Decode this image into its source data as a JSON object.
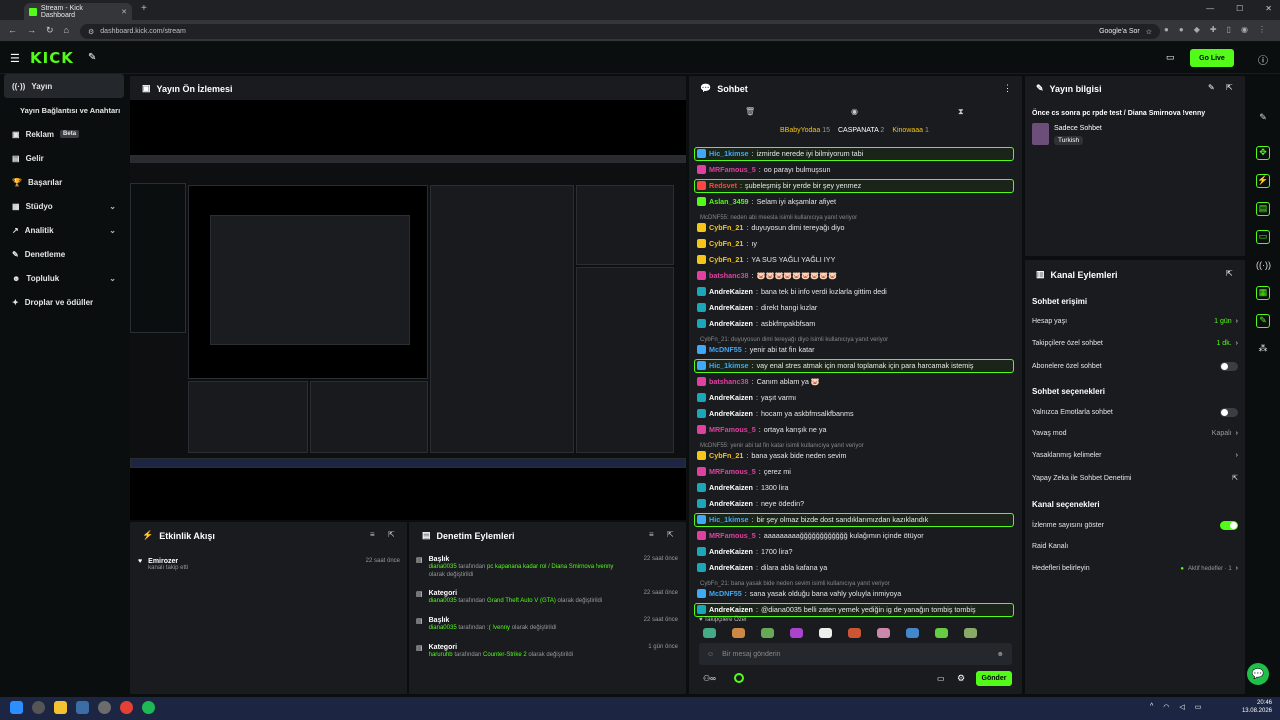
{
  "browser": {
    "tab_title": "Stream - Kick Dashboard",
    "url": "dashboard.kick.com/stream",
    "google_label": "Google'a Sor"
  },
  "header": {
    "logo": "KICK",
    "go_live": "Go Live"
  },
  "sidebar": {
    "items": [
      {
        "label": "Yayın",
        "icon": "broadcast-icon",
        "active": true
      },
      {
        "label": "Yayın Bağlantısı ve Anahtarı",
        "icon": "",
        "sub": true
      },
      {
        "label": "Reklam",
        "icon": "ad-icon",
        "badge": "Beta"
      },
      {
        "label": "Gelir",
        "icon": "revenue-icon"
      },
      {
        "label": "Başarılar",
        "icon": "trophy-icon"
      },
      {
        "label": "Stüdyo",
        "icon": "studio-icon",
        "chev": true
      },
      {
        "label": "Analitik",
        "icon": "analytics-icon",
        "chev": true
      },
      {
        "label": "Denetleme",
        "icon": "moderation-icon"
      },
      {
        "label": "Topluluk",
        "icon": "community-icon",
        "chev": true
      },
      {
        "label": "Droplar ve ödüller",
        "icon": "gift-icon"
      }
    ]
  },
  "preview": {
    "title": "Yayın Ön İzlemesi"
  },
  "activity": {
    "title": "Etkinlik Akışı",
    "items": [
      {
        "user": "Emirozer",
        "text": "kanalı takip etti",
        "time": "22 saat önce"
      }
    ]
  },
  "mod": {
    "title": "Denetim Eylemleri",
    "items": [
      {
        "type": "Başlık",
        "user": "diana0035",
        "mid": "tarafından",
        "value": "pc kapanana kadar rol / Diana Smirnova !venny",
        "end": "olarak değiştirildi",
        "time": "22 saat önce"
      },
      {
        "type": "Kategori",
        "user": "diana0035",
        "mid": "tarafından",
        "value": "Grand Theft Auto V (GTA)",
        "end": "olarak değiştirildi",
        "time": "22 saat önce"
      },
      {
        "type": "Başlık",
        "user": "diana0035",
        "mid": "tarafından",
        "value": ":( !venny",
        "end": "olarak değiştirildi",
        "time": "22 saat önce"
      },
      {
        "type": "Kategori",
        "user": "haruruhb",
        "mid": "tarafından",
        "value": "Counter-Strike 2",
        "end": "olarak değiştirildi",
        "time": "1 gün önce"
      }
    ]
  },
  "chat": {
    "title": "Sohbet",
    "gifters": [
      {
        "name": "BBabyYodaa",
        "n": "15"
      },
      {
        "name": "CASPANATA",
        "n": "2"
      },
      {
        "name": "Kinowaaa",
        "n": "1"
      }
    ],
    "messages": [
      {
        "user": "Hic_1kimse",
        "text": "izmirde nerede iyi bilmiyorum tabi",
        "color": "#3fa9f5",
        "hl": true
      },
      {
        "user": "MRFamous_5",
        "text": "oo parayı bulmuşsun",
        "color": "#e040a0"
      },
      {
        "user": "Redsvet",
        "text": "şubeleşmiş bir yerde bir şey yenmez",
        "color": "#ff4444",
        "hl": true
      },
      {
        "user": "Aslan_3459",
        "text": "Selam iyi akşamlar afiyet",
        "color": "#53fc18"
      },
      {
        "reply": "McDNF55: neden abi meesla isimli kullanıcıya yanıt veriyor"
      },
      {
        "user": "CybFn_21",
        "text": "duyuyosun dimi tereyağı diyo",
        "color": "#f5c518"
      },
      {
        "user": "CybFn_21",
        "text": "ıy",
        "color": "#f5c518"
      },
      {
        "user": "CybFn_21",
        "text": "YA SUS YAĞLI YAĞLI IYY",
        "color": "#f5c518"
      },
      {
        "user": "batshanc38",
        "text": "🐷🐷🐷🐷🐷🐷🐷🐷🐷",
        "color": "#e040a0"
      },
      {
        "user": "AndreKaizen",
        "text": "bana tek bi info verdi kızlarla gittim dedi",
        "color": "#fff"
      },
      {
        "user": "AndreKaizen",
        "text": "direkt hangi kızlar",
        "color": "#fff"
      },
      {
        "user": "AndreKaizen",
        "text": "asbkfmpakbfsam",
        "color": "#fff"
      },
      {
        "reply": "CybFn_21: duyuyosun dimi tereyağı diyo isimli kullanıcıya yanıt veriyor"
      },
      {
        "user": "McDNF55",
        "text": "yenir abi tat fin katar",
        "color": "#3fa9f5"
      },
      {
        "user": "Hic_1kimse",
        "text": "vay enal stres atmak için moral toplamak için para harcamak istemiş",
        "color": "#3fa9f5",
        "hl": true
      },
      {
        "user": "batshanc38",
        "text": "Canım ablam ya 🐷",
        "color": "#e040a0"
      },
      {
        "user": "AndreKaizen",
        "text": "yaşıt varmı",
        "color": "#fff"
      },
      {
        "user": "AndreKaizen",
        "text": "hocam ya askbfmsalkfbanms",
        "color": "#fff"
      },
      {
        "user": "MRFamous_5",
        "text": "ortaya karışık ne ya",
        "color": "#e040a0"
      },
      {
        "reply": "McDNF55: yenir abi tat fin katar isimli kullanıcıya yanıt veriyor"
      },
      {
        "user": "CybFn_21",
        "text": "bana yasak bide neden sevim",
        "color": "#f5c518"
      },
      {
        "user": "MRFamous_5",
        "text": "çerez mi",
        "color": "#e040a0"
      },
      {
        "user": "AndreKaizen",
        "text": "1300 lira",
        "color": "#fff"
      },
      {
        "user": "AndreKaizen",
        "text": "neye ödedin?",
        "color": "#fff"
      },
      {
        "user": "Hic_1kimse",
        "text": "bir şey olmaz bizde dost sandıklarımızdan kazıklandık",
        "color": "#3fa9f5",
        "hl": true
      },
      {
        "user": "MRFamous_5",
        "text": "aaaaaaaaağğğğğğğğğğğğ kulağımın içinde ötüyor",
        "color": "#e040a0"
      },
      {
        "user": "AndreKaizen",
        "text": "1700 lira?",
        "color": "#fff"
      },
      {
        "user": "AndreKaizen",
        "text": "dilara abla kafana ya",
        "color": "#fff"
      },
      {
        "reply": "CybFn_21: bana yasak bide neden sevim isimli kullanıcıya yanıt veriyor"
      },
      {
        "user": "McDNF55",
        "text": "sana yasak olduğu bana vahly yoluyla inmiyoya",
        "color": "#3fa9f5"
      },
      {
        "user": "AndreKaizen",
        "text": "@diana0035 belli zaten yemek yediğin ig de yanağın tombiş tombiş",
        "color": "#fff",
        "hl": true
      }
    ],
    "emote_label": "Takipçilere Özel",
    "input_placeholder": "Bir mesaj gönderin",
    "send": "Gönder"
  },
  "info": {
    "title": "Yayın bilgisi",
    "stream_title": "Önce cs sonra pc rpde test / Diana Smirnova !venny",
    "category": "Sadece Sohbet",
    "language": "Turkish"
  },
  "actions": {
    "title": "Kanal Eylemleri",
    "s1": "Sohbet erişimi",
    "rows1": [
      {
        "label": "Hesap yaşı",
        "val": "1 gün"
      },
      {
        "label": "Takipçilere özel sohbet",
        "val": "1 dk."
      },
      {
        "label": "Abonelere özel sohbet",
        "toggle": false
      }
    ],
    "s2": "Sohbet seçenekleri",
    "rows2": [
      {
        "label": "Yalnızca Emotlarla sohbet",
        "toggle": false
      },
      {
        "label": "Yavaş mod",
        "val": "Kapalı"
      },
      {
        "label": "Yasaklanmış kelimeler",
        "val": ""
      },
      {
        "label": "Yapay Zeka ile Sohbet Denetimi",
        "val": ""
      }
    ],
    "s3": "Kanal seçenekleri",
    "rows3": [
      {
        "label": "İzlenme sayısını göster",
        "toggle": true
      },
      {
        "label": "Raid Kanalı",
        "val": ""
      },
      {
        "label": "Hedefleri belirleyin",
        "val": "Aktif hedefler · 1"
      }
    ]
  },
  "clock": {
    "time": "20:46",
    "date": "13.08.2026"
  }
}
